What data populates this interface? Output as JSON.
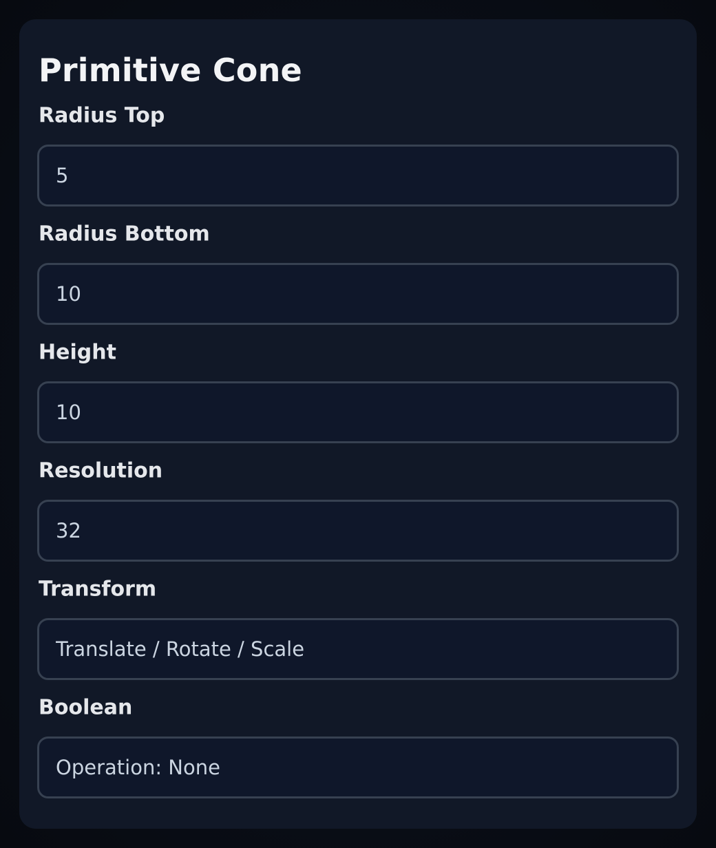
{
  "panel": {
    "title": "Primitive Cone",
    "fields": [
      {
        "label": "Radius Top",
        "value": "5"
      },
      {
        "label": "Radius Bottom",
        "value": "10"
      },
      {
        "label": "Height",
        "value": "10"
      },
      {
        "label": "Resolution",
        "value": "32"
      },
      {
        "label": "Transform",
        "value": "Translate / Rotate / Scale"
      },
      {
        "label": "Boolean",
        "value": "Operation: None"
      }
    ]
  },
  "colors": {
    "page_background": "#070a10",
    "panel_background": "#111827",
    "input_background": "#0f172a",
    "input_border": "#374151",
    "label_text": "#e5e7eb",
    "value_text": "#cbd5e1"
  }
}
